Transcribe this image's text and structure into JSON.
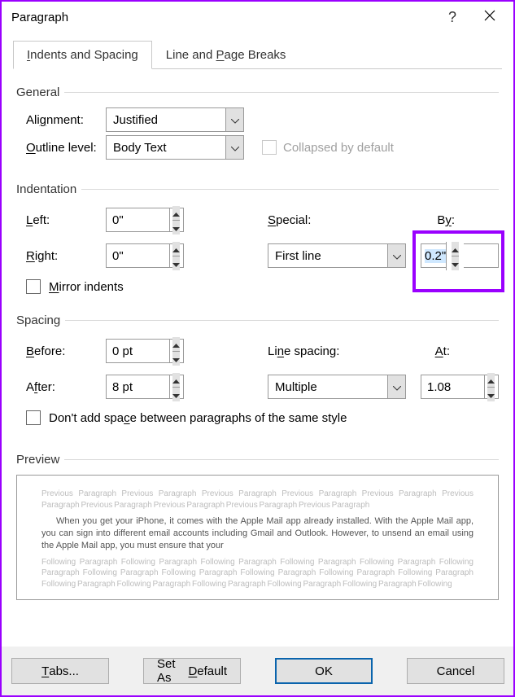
{
  "title": "Paragraph",
  "tabs": {
    "indents": "Indents and Spacing",
    "breaks": "Line and Page Breaks"
  },
  "general": {
    "legend": "General",
    "alignment_label": "Alignment:",
    "alignment_value": "Justified",
    "outline_label": "Outline level:",
    "outline_value": "Body Text",
    "collapsed_label": "Collapsed by default"
  },
  "indentation": {
    "legend": "Indentation",
    "left_label": "Left:",
    "left_value": "0\"",
    "right_label": "Right:",
    "right_value": "0\"",
    "special_label": "Special:",
    "special_value": "First line",
    "by_label": "By:",
    "by_value": "0.2\"",
    "mirror_label": "Mirror indents"
  },
  "spacing": {
    "legend": "Spacing",
    "before_label": "Before:",
    "before_value": "0 pt",
    "after_label": "After:",
    "after_value": "8 pt",
    "line_label": "Line spacing:",
    "line_value": "Multiple",
    "at_label": "At:",
    "at_value": "1.08",
    "dont_add_label": "Don't add space between paragraphs of the same style"
  },
  "preview": {
    "legend": "Preview",
    "previous": "Previous Paragraph Previous Paragraph Previous Paragraph Previous Paragraph Previous Paragraph Previous Paragraph Previous Paragraph Previous Paragraph Previous Paragraph Previous Paragraph",
    "sample": "When you get your iPhone, it comes with the Apple Mail app already installed. With the Apple Mail app, you can sign into different email accounts including Gmail and Outlook. However, to unsend an email using the Apple Mail app, you must ensure that your",
    "following": "Following Paragraph Following Paragraph Following Paragraph Following Paragraph Following Paragraph Following Paragraph Following Paragraph Following Paragraph Following Paragraph Following Paragraph Following Paragraph Following Paragraph Following Paragraph Following Paragraph Following Paragraph Following Paragraph Following"
  },
  "buttons": {
    "tabs": "Tabs...",
    "set_default": "Set As Default",
    "ok": "OK",
    "cancel": "Cancel"
  }
}
